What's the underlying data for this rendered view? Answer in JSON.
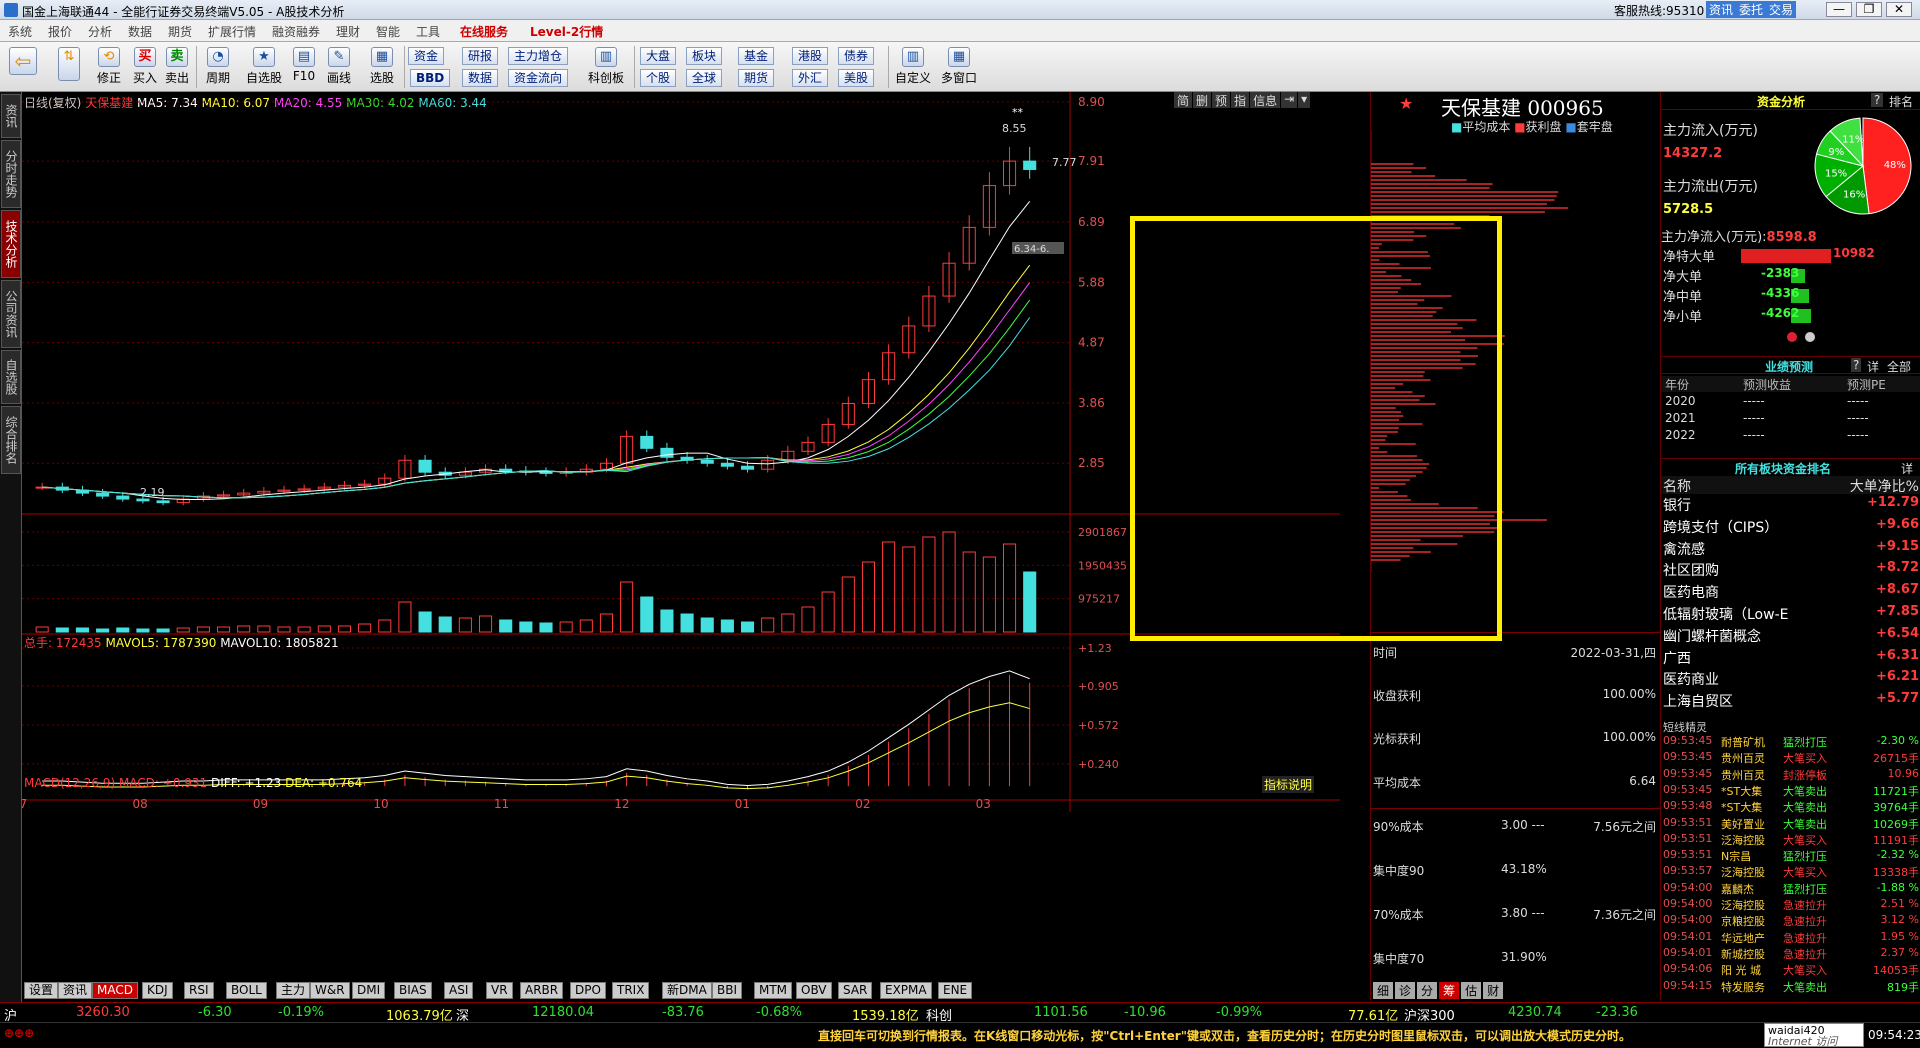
{
  "window": {
    "title": "国金上海联通44 - 全能行证券交易终端V5.05 - A股技术分析",
    "hotline": "客服热线:95310",
    "btn_info": "资讯",
    "btn_trust": "委托",
    "btn_trade": "交易"
  },
  "menu": [
    "系统",
    "报价",
    "分析",
    "数据",
    "期货",
    "扩展行情",
    "融资融券",
    "理财",
    "智能",
    "工具",
    "在线服务",
    "Level-2行情"
  ],
  "toolbar": {
    "big": [
      {
        "label": "",
        "icon": "⇦"
      },
      {
        "label": "修正",
        "icon": "⇅"
      },
      {
        "label": "买入",
        "icon": "买"
      },
      {
        "label": "卖出",
        "icon": "卖"
      },
      {
        "label": "周期",
        "icon": "◔"
      },
      {
        "label": "自选股",
        "icon": "★"
      },
      {
        "label": "F10",
        "icon": "▤"
      },
      {
        "label": "画线",
        "icon": "✎"
      },
      {
        "label": "选股",
        "icon": "▦"
      }
    ],
    "small": [
      "资金",
      "研报",
      "主力增仓",
      "BBD",
      "数据",
      "资金流向",
      "科创板",
      "大盘",
      "板块",
      "基金",
      "港股",
      "债券",
      "个股",
      "全球",
      "期货",
      "外汇",
      "美股"
    ],
    "right": [
      {
        "label": "自定义",
        "icon": "▥"
      },
      {
        "label": "多窗口",
        "icon": "▦"
      }
    ]
  },
  "left_tabs": [
    "资讯",
    "分时走势",
    "技术分析",
    "公司资讯",
    "自选股",
    "综合排名"
  ],
  "chart_header": {
    "period": "日线(复权)",
    "name": "天保基建",
    "ma5": "MA5: 7.34",
    "ma10": "MA10: 6.07",
    "ma20": "MA20: 4.55",
    "ma30": "MA30: 4.02",
    "ma60": "MA60: 3.44",
    "buttons": [
      "简",
      "删",
      "预",
      "指",
      "信息"
    ]
  },
  "vol_header": {
    "label": "总手: 172435",
    "mavol5": "MAVOL5: 1787390",
    "mavol10": "MAVOL10: 1805821"
  },
  "macd_header": {
    "label": "MACD(12,26,9) MACD: +0.931",
    "diff": "DIFF: +1.23",
    "dea": "DEA: +0.764",
    "explain": "指标说明"
  },
  "chart_data": [
    {
      "type": "candlestick",
      "title": "天保基建",
      "y_ticks": [
        "8.90",
        "7.91",
        "6.89",
        "5.88",
        "4.87",
        "3.86",
        "2.85"
      ],
      "ylim": [
        2.0,
        8.9
      ],
      "x_ticks": [
        "07",
        "08",
        "09",
        "10",
        "11",
        "12",
        "01",
        "02",
        "03"
      ],
      "annotations": [
        "8.55",
        "7.77",
        "2.19",
        "6.34-6.",
        "**"
      ],
      "close": [
        2.45,
        2.4,
        2.35,
        2.3,
        2.25,
        2.22,
        2.19,
        2.25,
        2.3,
        2.32,
        2.35,
        2.38,
        2.4,
        2.42,
        2.45,
        2.48,
        2.5,
        2.6,
        2.9,
        2.7,
        2.65,
        2.7,
        2.75,
        2.72,
        2.7,
        2.68,
        2.7,
        2.75,
        2.85,
        3.3,
        3.1,
        2.95,
        2.9,
        2.85,
        2.8,
        2.75,
        2.9,
        3.05,
        3.2,
        3.5,
        3.85,
        4.25,
        4.7,
        5.15,
        5.65,
        6.2,
        6.8,
        7.5,
        7.91,
        7.77
      ],
      "series": [
        {
          "name": "MA5",
          "color": "#ffffff"
        },
        {
          "name": "MA10",
          "color": "#ffff3c"
        },
        {
          "name": "MA20",
          "color": "#ff44ff"
        },
        {
          "name": "MA30",
          "color": "#3cff3c"
        },
        {
          "name": "MA60",
          "color": "#44e0e0"
        }
      ]
    },
    {
      "type": "bar",
      "title": "成交量",
      "y_ticks": [
        "2901867",
        "1950435",
        "975217"
      ],
      "values": [
        5,
        4,
        4,
        3,
        4,
        3,
        3,
        4,
        5,
        5,
        6,
        6,
        5,
        5,
        6,
        6,
        8,
        12,
        30,
        20,
        15,
        14,
        16,
        12,
        10,
        9,
        10,
        12,
        18,
        50,
        35,
        22,
        18,
        14,
        12,
        10,
        14,
        18,
        25,
        40,
        55,
        70,
        90,
        85,
        95,
        100,
        80,
        75,
        88,
        60
      ]
    },
    {
      "type": "bar",
      "title": "MACD",
      "y_ticks": [
        "+1.23",
        "+0.905",
        "+0.572",
        "+0.240"
      ],
      "values": [
        0.01,
        0.01,
        0.0,
        -0.01,
        -0.01,
        -0.01,
        0.0,
        0.01,
        0.01,
        0.02,
        0.02,
        0.02,
        0.02,
        0.02,
        0.02,
        0.03,
        0.04,
        0.06,
        0.1,
        0.08,
        0.06,
        0.05,
        0.04,
        0.03,
        0.02,
        0.02,
        0.02,
        0.03,
        0.05,
        0.12,
        0.1,
        0.06,
        0.03,
        0.01,
        -0.02,
        -0.03,
        -0.02,
        0.01,
        0.05,
        0.1,
        0.18,
        0.28,
        0.4,
        0.52,
        0.65,
        0.78,
        0.88,
        0.95,
        1.0,
        0.93
      ]
    }
  ],
  "chip": {
    "title": "天保基建 000965",
    "legend": [
      "平均成本",
      "获利盘",
      "套牢盘"
    ],
    "time_label": "时间",
    "time_value": "2022-03-31,四",
    "rows": [
      {
        "k": "收盘获利",
        "v": "100.00%"
      },
      {
        "k": "光标获利",
        "v": "100.00%"
      },
      {
        "k": "平均成本",
        "v": "6.64"
      }
    ],
    "c90": {
      "k": "90%成本",
      "a": "3.00 ---",
      "b": "7.56元之间",
      "conc_k": "集中度90",
      "conc_v": "43.18%"
    },
    "c70": {
      "k": "70%成本",
      "a": "3.80 ---",
      "b": "7.36元之间",
      "conc_k": "集中度70",
      "conc_v": "31.90%"
    },
    "tabs": [
      "细",
      "诊",
      "分",
      "筹",
      "估",
      "财"
    ]
  },
  "fund": {
    "title": "资金分析",
    "help": "?",
    "rank": "排名",
    "inflow_label": "主力流入(万元)",
    "inflow": "14327.2",
    "outflow_label": "主力流出(万元)",
    "outflow": "5728.5",
    "net_label": "主力净流入(万元):",
    "net": "8598.8",
    "pie": [
      "48%",
      "16%",
      "15%",
      "9%",
      "11%"
    ],
    "rows": [
      {
        "k": "净特大单",
        "v": "10982"
      },
      {
        "k": "净大单",
        "v": "-2383"
      },
      {
        "k": "净中单",
        "v": "-4336"
      },
      {
        "k": "净小单",
        "v": "-4262"
      }
    ]
  },
  "forecast": {
    "title": "业绩预测",
    "q": "?",
    "detail": "详",
    "all": "全部",
    "head": [
      "年份",
      "预测收益",
      "预测PE"
    ],
    "rows": [
      [
        "2020",
        "-----",
        "-----"
      ],
      [
        "2021",
        "-----",
        "-----"
      ],
      [
        "2022",
        "-----",
        "-----"
      ]
    ]
  },
  "sector": {
    "title": "所有板块资金排名",
    "detail": "详",
    "head": [
      "名称",
      "大单净比%"
    ],
    "rows": [
      [
        "银行",
        "+12.79"
      ],
      [
        "跨境支付（CIPS）",
        "+9.66"
      ],
      [
        "禽流感",
        "+9.15"
      ],
      [
        "社区团购",
        "+8.72"
      ],
      [
        "医药电商",
        "+8.67"
      ],
      [
        "低辐射玻璃（Low-E",
        "+7.85"
      ],
      [
        "幽门螺杆菌概念",
        "+6.54"
      ],
      [
        "广西",
        "+6.31"
      ],
      [
        "医药商业",
        "+6.21"
      ],
      [
        "上海自贸区",
        "+5.77"
      ]
    ]
  },
  "elves": {
    "title": "短线精灵",
    "rows": [
      [
        "09:53:45",
        "耐普矿机",
        "猛烈打压",
        "-2.30 %"
      ],
      [
        "09:53:45",
        "贵州百灵",
        "大笔买入",
        "26715手"
      ],
      [
        "09:53:45",
        "贵州百灵",
        "封涨停板",
        "10.96"
      ],
      [
        "09:53:45",
        "*ST大集",
        "大笔卖出",
        "11721手"
      ],
      [
        "09:53:48",
        "*ST大集",
        "大笔卖出",
        "39764手"
      ],
      [
        "09:53:51",
        "美好置业",
        "大笔卖出",
        "10269手"
      ],
      [
        "09:53:51",
        "泛海控股",
        "大笔买入",
        "11191手"
      ],
      [
        "09:53:51",
        "N宗昌",
        "猛烈打压",
        "-2.32 %"
      ],
      [
        "09:53:57",
        "泛海控股",
        "大笔买入",
        "13338手"
      ],
      [
        "09:54:00",
        "嘉麟杰",
        "猛烈打压",
        "-1.88 %"
      ],
      [
        "09:54:00",
        "泛海控股",
        "急速拉升",
        "2.51 %"
      ],
      [
        "09:54:00",
        "京粮控股",
        "急速拉升",
        "3.12 %"
      ],
      [
        "09:54:01",
        "华远地产",
        "急速拉升",
        "1.95 %"
      ],
      [
        "09:54:01",
        "新城控股",
        "急速拉升",
        "2.37 %"
      ],
      [
        "09:54:06",
        "阳 光 城",
        "大笔买入",
        "14053手"
      ],
      [
        "09:54:15",
        "特发服务",
        "大笔卖出",
        "819手"
      ]
    ]
  },
  "indicator_tabs": [
    "设置",
    "资讯",
    "MACD",
    "KDJ",
    "RSI",
    "BOLL",
    "主力",
    "W&R",
    "DMI",
    "BIAS",
    "ASI",
    "VR",
    "ARBR",
    "DPO",
    "TRIX",
    "新DMA",
    "BBI",
    "MTM",
    "OBV",
    "SAR",
    "EXPMA",
    "ENE"
  ],
  "status": {
    "sh": "沪",
    "sh_v": "3260.30",
    "sh_c": "-6.30",
    "sh_p": "-0.19%",
    "sh_amt": "1063.79亿",
    "sz": "深",
    "sz_v": "12180.04",
    "sz_c": "-83.76",
    "sz_p": "-0.68%",
    "sz_amt": "1539.18亿",
    "kc": "科创",
    "kc_v": "1101.56",
    "kc_c": "-10.96",
    "kc_p": "-0.99%",
    "kc_amt": "77.61亿",
    "hs": "沪深300",
    "hs_v": "4230.74",
    "hs_c": "-23.36",
    "tip": "直接回车可切换到行情报表。在K线窗口移动光标，按\"Ctrl+Enter\"键或双击，查看历史分时；在历史分时图里鼠标双击，可以调出放大模式历史分时。",
    "time": "09:54:23",
    "ime": "waidai420",
    "ime2": "Internet 访问"
  }
}
